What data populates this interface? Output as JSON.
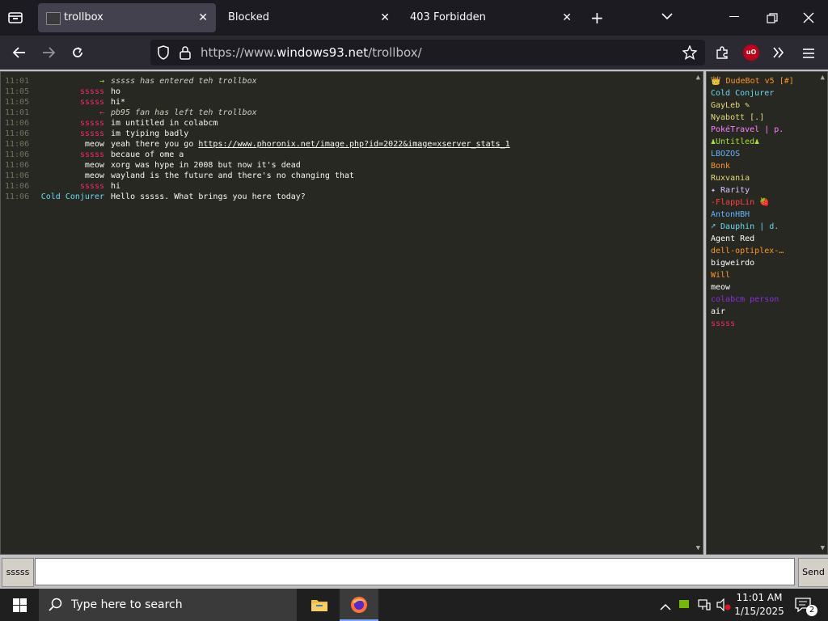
{
  "browser": {
    "tabs": [
      {
        "label": "trollbox",
        "active": true
      },
      {
        "label": "Blocked",
        "active": false
      },
      {
        "label": "403 Forbidden",
        "active": false
      }
    ],
    "url_prefix": "https://www.",
    "url_host": "windows93.net",
    "url_path": "/trollbox/",
    "extension_badge": "uO"
  },
  "chat": {
    "messages": [
      {
        "time": "11:01",
        "nick": "→",
        "nick_color": "#a6e22e",
        "text": "sssss has entered teh trollbox",
        "italic": true
      },
      {
        "time": "11:05",
        "nick": "sssss",
        "nick_color": "#f92672",
        "text": "ho"
      },
      {
        "time": "11:05",
        "nick": "sssss",
        "nick_color": "#f92672",
        "text": "hi*"
      },
      {
        "time": "11:01",
        "nick": "←",
        "nick_color": "#f92672",
        "text": "pb95 fan has left teh trollbox",
        "italic": true
      },
      {
        "time": "11:06",
        "nick": "sssss",
        "nick_color": "#f92672",
        "text": "im untitled in colabcm"
      },
      {
        "time": "11:06",
        "nick": "sssss",
        "nick_color": "#f92672",
        "text": "im tyiping badly"
      },
      {
        "time": "11:06",
        "nick": "meow",
        "nick_color": "#f8f8f2",
        "text": "yeah there you go ",
        "link": "https://www.phoronix.net/image.php?id=2022&image=xserver_stats_1"
      },
      {
        "time": "11:06",
        "nick": "sssss",
        "nick_color": "#f92672",
        "text": "becaue of ome a"
      },
      {
        "time": "11:06",
        "nick": "meow",
        "nick_color": "#f8f8f2",
        "text": "xorg was hype in 2008 but now it's dead"
      },
      {
        "time": "11:06",
        "nick": "meow",
        "nick_color": "#f8f8f2",
        "text": "wayland is the future and there's no changing that"
      },
      {
        "time": "11:06",
        "nick": "sssss",
        "nick_color": "#f92672",
        "text": "hi"
      },
      {
        "time": "11:06",
        "nick": "Cold Conjurer",
        "nick_color": "#66d9ef",
        "text": "Hello sssss. What brings you here today?"
      }
    ]
  },
  "users": [
    {
      "name": "👑 DudeBot v5 [#]",
      "color": "#fd971f"
    },
    {
      "name": "Cold Conjurer",
      "color": "#66d9ef"
    },
    {
      "name": "GayLeb ✎",
      "color": "#e6db74"
    },
    {
      "name": "Nyabott [.]",
      "color": "#e6db74"
    },
    {
      "name": "PokéTravel | p.",
      "color": "#ff80ff"
    },
    {
      "name": "♟Untitled♟",
      "color": "#a6e22e"
    },
    {
      "name": "LBOZOS",
      "color": "#66b3ff"
    },
    {
      "name": "Bonk",
      "color": "#fd971f"
    },
    {
      "name": "Ruxvania",
      "color": "#e6db74"
    },
    {
      "name": "✦ Rarity",
      "color": "#e0c0ff"
    },
    {
      "name": "-FlappLin 🍓",
      "color": "#ff4040"
    },
    {
      "name": "AntonHBH",
      "color": "#66b3ff"
    },
    {
      "name": "➚ Dauphin | d.",
      "color": "#66d9ef"
    },
    {
      "name": "Agent Red",
      "color": "#ffffff"
    },
    {
      "name": "dell-optiplex-…",
      "color": "#fd971f"
    },
    {
      "name": "bigweirdo",
      "color": "#ffffff"
    },
    {
      "name": "Will",
      "color": "#fd971f"
    },
    {
      "name": "meow",
      "color": "#ffffff"
    },
    {
      "name": "colabcm person",
      "color": "#8a2be2"
    },
    {
      "name": "air",
      "color": "#ffffff"
    },
    {
      "name": "sssss",
      "color": "#f92672"
    }
  ],
  "input": {
    "nick_button": "sssss",
    "message_value": "",
    "send_button": "Send"
  },
  "taskbar": {
    "search_placeholder": "Type here to search",
    "time": "11:01 AM",
    "date": "1/15/2025",
    "notification_count": "2"
  }
}
